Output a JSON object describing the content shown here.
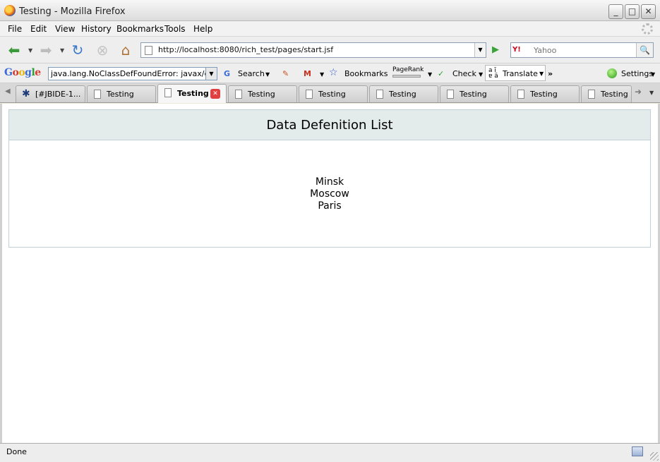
{
  "window": {
    "title": "Testing - Mozilla Firefox"
  },
  "menubar": {
    "items": [
      "File",
      "Edit",
      "View",
      "History",
      "Bookmarks",
      "Tools",
      "Help"
    ]
  },
  "navbar": {
    "url": "http://localhost:8080/rich_test/pages/start.jsf",
    "search_placeholder": "Yahoo",
    "search_engine": "Y!"
  },
  "google_toolbar": {
    "logo": "Google",
    "search_value": "java.lang.NoClassDefFoundError: javax/el/C",
    "search_label": "Search",
    "bookmarks_label": "Bookmarks",
    "pagerank_label": "PageRank",
    "check_label": "Check",
    "translate_label": "Translate",
    "more_label": "»",
    "settings_label": "Settings"
  },
  "tabs": [
    {
      "label": "[#JBIDE-1..."
    },
    {
      "label": "Testing"
    },
    {
      "label": "Testing",
      "active": true
    },
    {
      "label": "Testing"
    },
    {
      "label": "Testing"
    },
    {
      "label": "Testing"
    },
    {
      "label": "Testing"
    },
    {
      "label": "Testing"
    },
    {
      "label": "Testing"
    }
  ],
  "page": {
    "heading": "Data Defenition List",
    "items": [
      "Minsk",
      "Moscow",
      "Paris"
    ]
  },
  "status": {
    "text": "Done"
  },
  "colors": {
    "panel_header_bg": "#e3eceb",
    "panel_border": "#c0cfd8"
  }
}
